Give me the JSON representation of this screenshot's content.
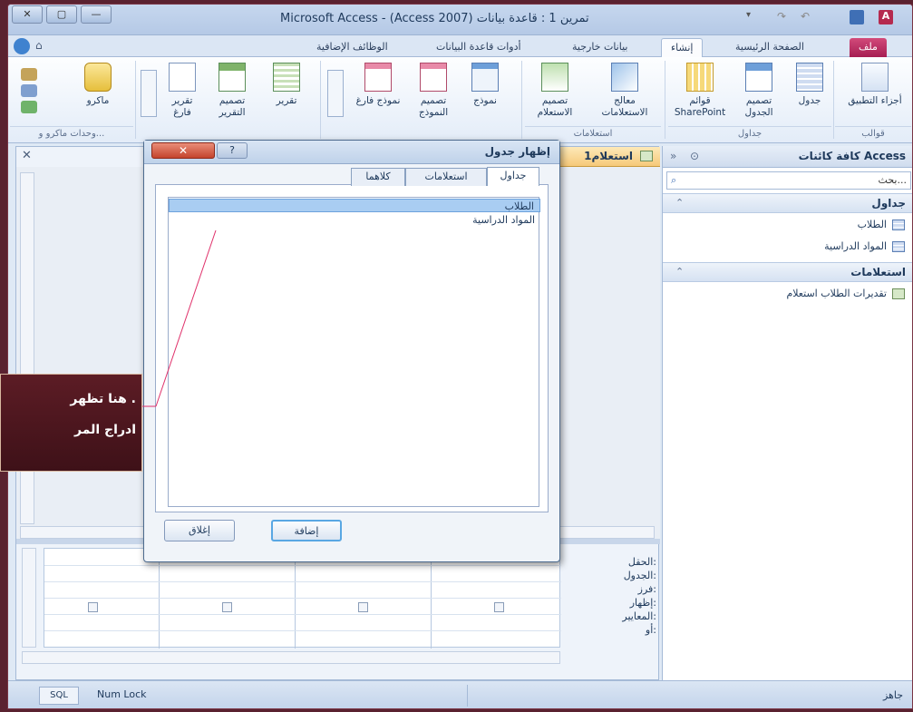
{
  "titlebar": {
    "title": "Microsoft Access - (Access 2007) تمرين 1 : قاعدة بيانات"
  },
  "ribbon_tabs": [
    "ملف",
    "الصفحة الرئيسية",
    "إنشاء",
    "بيانات خارجية",
    "أدوات قاعدة البيانات",
    "الوظائف الإضافية"
  ],
  "ribbon": {
    "groups": {
      "templates": "قوالب",
      "tables": "جداول",
      "queries": "استعلامات",
      "forms": "",
      "reports": "",
      "macros": "وحدات ماكرو و..."
    },
    "buttons": {
      "app_parts": "أجزاء التطبيق",
      "table": "جدول",
      "table_design": "تصميم الجدول",
      "sharepoint": "قوائم SharePoint",
      "query_wizard": "معالج الاستعلامات",
      "query_design": "تصميم الاستعلام",
      "form": "نموذج",
      "form_design": "تصميم النموذج",
      "blank_form": "نموذج فارغ",
      "report": "تقرير",
      "report_design": "تصميم التقرير",
      "blank_report": "تقرير فارغ",
      "macro": "ماكرو"
    }
  },
  "navpane": {
    "title": "كافة كائنات Access",
    "search_placeholder": "بحث...",
    "groups": [
      {
        "label": "جداول",
        "items": [
          "الطلاب",
          "المواد الدراسية"
        ]
      },
      {
        "label": "استعلامات",
        "items": [
          "تقديرات الطلاب استعلام"
        ]
      }
    ]
  },
  "doc_tab": "استعلام1",
  "grid_labels": [
    "الحقل:",
    "الجدول:",
    "فرز:",
    "إظهار:",
    "المعايير:",
    "أو:"
  ],
  "dialog": {
    "title": "إظهار جدول",
    "tabs": [
      "جداول",
      "استعلامات",
      "كلاهما"
    ],
    "list": [
      "الطلاب",
      "المواد الدراسية"
    ],
    "add_button": "إضافة",
    "close_button": "إغلاق"
  },
  "callout": {
    "line1": "هنا تظهر .",
    "line2": "ادراج المر"
  },
  "statusbar": {
    "left": "جاهز",
    "numlock": "Num Lock",
    "sql": "SQL"
  },
  "colors": {
    "file_tab": "#b82a5c",
    "callout": "#4a1520",
    "selection": "#a9cdf2"
  }
}
